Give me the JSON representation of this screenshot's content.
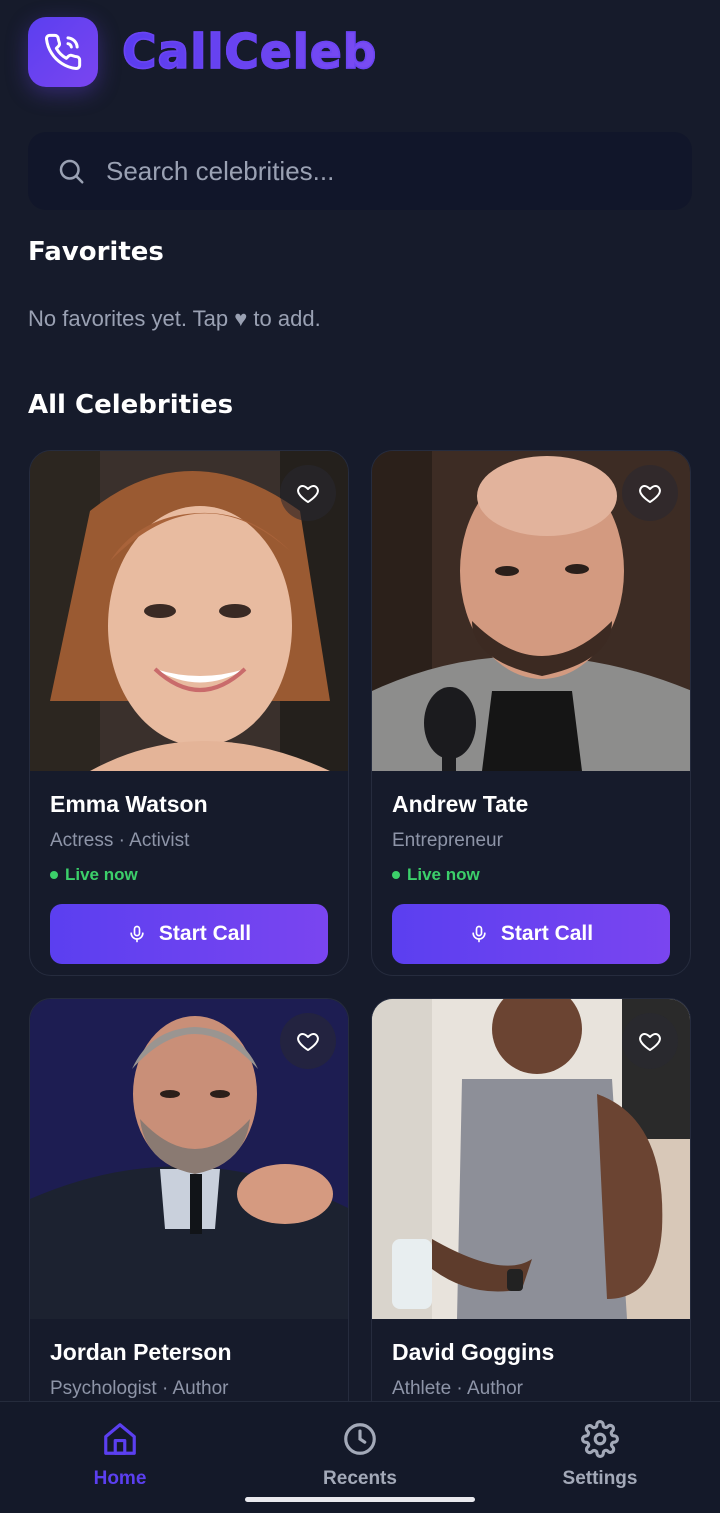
{
  "app": {
    "brand": "CallCeleb"
  },
  "search": {
    "placeholder": "Search celebrities..."
  },
  "favorites": {
    "title": "Favorites",
    "empty_text": "No favorites yet. Tap ♥ to add."
  },
  "all": {
    "title": "All Celebrities",
    "call_label": "Start Call",
    "live_label": "Live now",
    "cards": [
      {
        "name": "Emma Watson",
        "role": "Actress · Activist",
        "status": "Live now"
      },
      {
        "name": "Andrew Tate",
        "role": "Entrepreneur",
        "status": "Live now"
      },
      {
        "name": "Jordan Peterson",
        "role": "Psychologist · Author"
      },
      {
        "name": "David Goggins",
        "role": "Athlete · Author"
      }
    ]
  },
  "tabs": [
    {
      "label": "Home",
      "icon": "home-icon",
      "active": true
    },
    {
      "label": "Recents",
      "icon": "clock-icon",
      "active": false
    },
    {
      "label": "Settings",
      "icon": "gear-icon",
      "active": false
    }
  ],
  "colors": {
    "background": "#161b2b",
    "accent": "#5b3ff0",
    "accent_end": "#7a45f0",
    "live": "#3ccf6a",
    "muted": "#9aa1b3"
  }
}
